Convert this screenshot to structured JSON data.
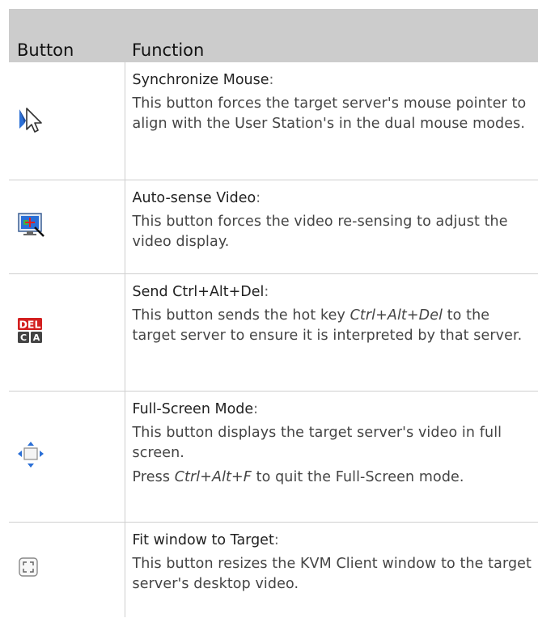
{
  "table": {
    "headers": {
      "button": "Button",
      "function": "Function"
    },
    "rows": [
      {
        "icon": "synchronize-mouse-icon",
        "name": "Synchronize Mouse",
        "colon": ":",
        "desc": [
          {
            "text": "This button forces the target server's mouse pointer to align with the User Station's in the dual mouse modes."
          }
        ]
      },
      {
        "icon": "auto-sense-video-icon",
        "name": "Auto-sense Video",
        "colon": ":",
        "desc": [
          {
            "text": "This button forces the video re-sensing to adjust the video display."
          }
        ]
      },
      {
        "icon": "send-ctrl-alt-del-icon",
        "name": "Send Ctrl+Alt+Del",
        "colon": ":",
        "desc": [
          {
            "pre": "This button sends the hot key ",
            "em": "Ctrl+Alt+Del",
            "post": " to the target server to ensure it is interpreted by that server."
          }
        ]
      },
      {
        "icon": "full-screen-mode-icon",
        "name": "Full-Screen Mode",
        "colon": ":",
        "desc": [
          {
            "text": "This button displays the target server's video in full screen."
          },
          {
            "pre": "Press ",
            "em": "Ctrl+Alt+F",
            "post": " to quit the Full-Screen mode."
          }
        ]
      },
      {
        "icon": "fit-window-to-target-icon",
        "name": "Fit window to Target",
        "colon": ":",
        "desc": [
          {
            "text": "This button resizes the KVM Client window to the target server's desktop video."
          }
        ]
      }
    ]
  },
  "colors": {
    "header_bg": "#cccccc",
    "border": "#cfcfcf",
    "del_red": "#d32020",
    "icon_blue": "#2a6fd6"
  }
}
